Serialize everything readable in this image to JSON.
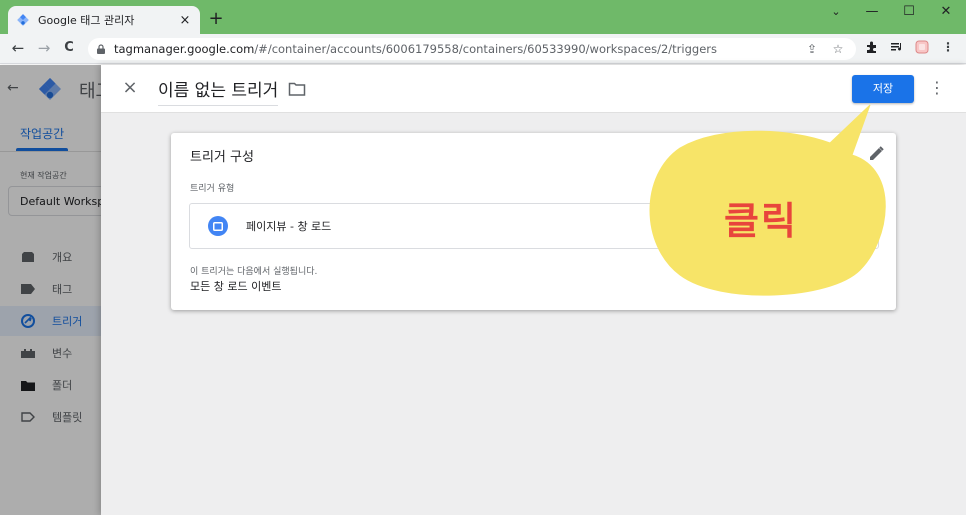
{
  "browser": {
    "tab_title": "Google 태그 관리자",
    "tab_close": "×",
    "new_tab": "+",
    "window_controls": {
      "minimize": "—",
      "maximize": "☐",
      "close": "✕",
      "dropdown": "⌄"
    },
    "nav": {
      "back": "←",
      "forward": "→",
      "reload": "C"
    },
    "url_host": "tagmanager.google.com",
    "url_path": "/#/container/accounts/6006179558/containers/60533990/workspaces/2/triggers",
    "icons": [
      "share-icon",
      "star-icon",
      "extensions-icon",
      "media-icon",
      "profile-icon",
      "menu-icon"
    ]
  },
  "gtm": {
    "app_title": "태그",
    "back_arrow": "←",
    "workspace_tab": "작업공간",
    "current_workspace_label": "현재 작업공간",
    "workspace_name": "Default Workspace",
    "nav_items": [
      {
        "label": "개요",
        "icon": "overview-icon",
        "active": false
      },
      {
        "label": "태그",
        "icon": "tag-icon",
        "active": false
      },
      {
        "label": "트리거",
        "icon": "trigger-icon",
        "active": true
      },
      {
        "label": "변수",
        "icon": "variable-icon",
        "active": false
      },
      {
        "label": "폴더",
        "icon": "folder-icon",
        "active": false
      },
      {
        "label": "템플릿",
        "icon": "template-icon",
        "active": false
      }
    ]
  },
  "panel": {
    "close": "×",
    "title": "이름 없는 트리거",
    "save_label": "저장",
    "more": "⋮",
    "card": {
      "title": "트리거 구성",
      "type_label": "트리거 유형",
      "type_name": "페이지뷰 - 창 로드",
      "fires_label": "이 트리거는 다음에서 실행됩니다.",
      "fires_value": "모든 창 로드 이벤트"
    }
  },
  "annotation": {
    "text": "클릭",
    "bubble_color": "#f7e468",
    "text_color": "#e8453c"
  }
}
